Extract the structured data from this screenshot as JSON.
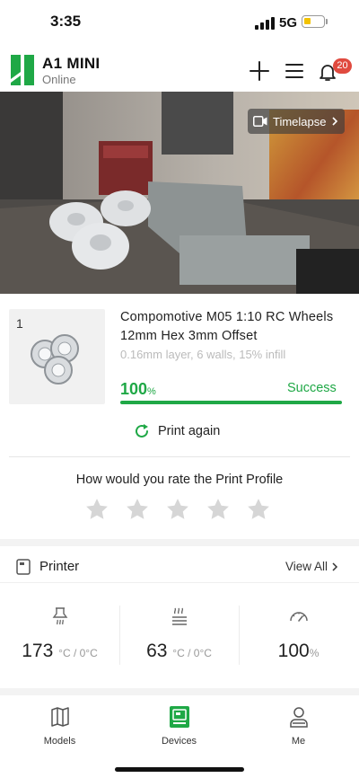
{
  "status_bar": {
    "time": "3:35",
    "network": "5G",
    "battery_color": "#f2c200"
  },
  "header": {
    "device_name": "A1 MINI",
    "device_status": "Online",
    "notifications_count": "20",
    "brand_color": "#1fa846"
  },
  "camera": {
    "timelapse_label": "Timelapse"
  },
  "job": {
    "plate_number": "1",
    "title": "Compomotive M05 1:10 RC Wheels 12mm Hex 3mm Offset",
    "details": "0.16mm layer, 6 walls, 15% infill",
    "progress_value": "100",
    "progress_unit": "%",
    "progress_fraction": 1.0,
    "result": "Success",
    "print_again_label": "Print again"
  },
  "rating": {
    "question": "How would you rate the Print Profile",
    "stars_total": 5,
    "stars_filled": 0
  },
  "printer_section": {
    "title": "Printer",
    "view_all_label": "View All",
    "stats": [
      {
        "icon": "nozzle-temperature-icon",
        "value": "173",
        "unit": "°C / 0°C"
      },
      {
        "icon": "bed-temperature-icon",
        "value": "63",
        "unit": "°C / 0°C"
      },
      {
        "icon": "speed-gauge-icon",
        "value": "100",
        "unit": "%"
      }
    ]
  },
  "bottom_nav": [
    {
      "label": "Models",
      "icon": "models-icon",
      "active": false
    },
    {
      "label": "Devices",
      "icon": "devices-icon",
      "active": true
    },
    {
      "label": "Me",
      "icon": "profile-icon",
      "active": false
    }
  ]
}
